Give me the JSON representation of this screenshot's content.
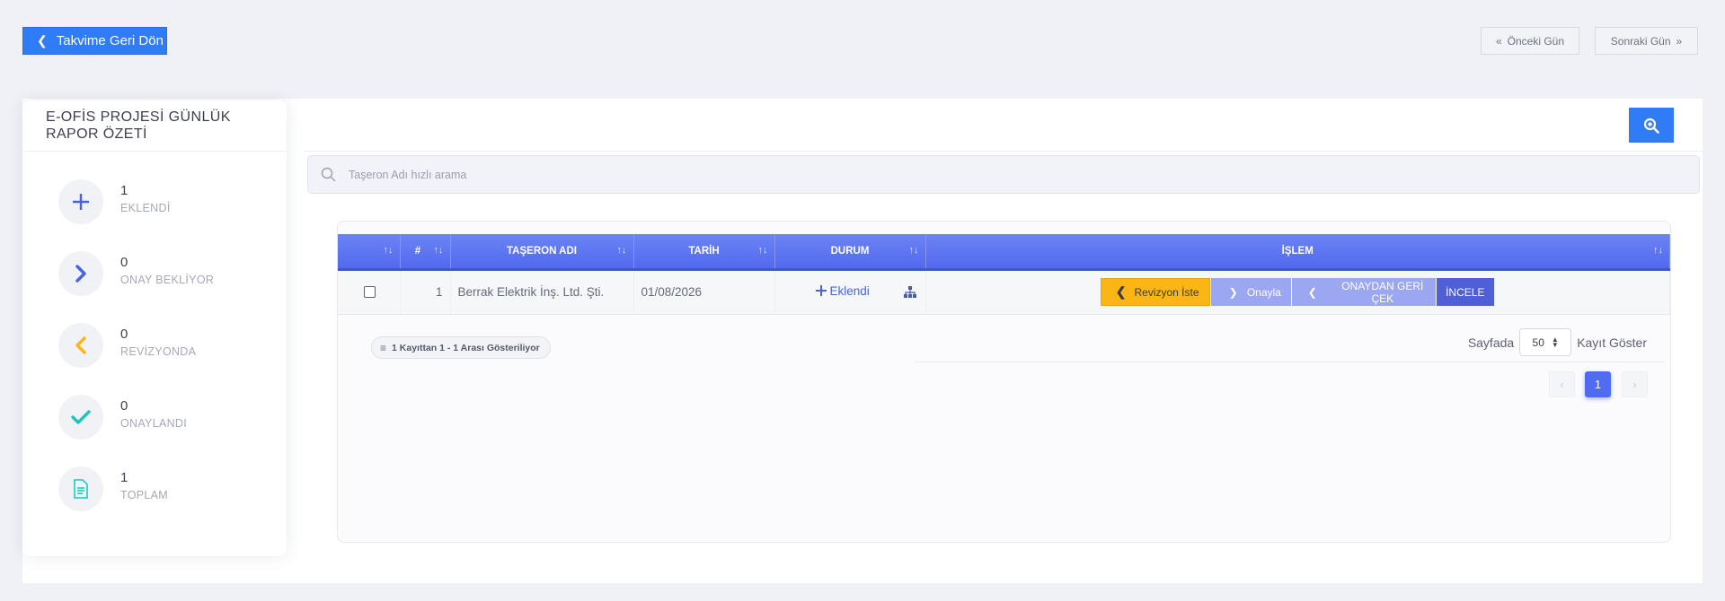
{
  "header": {
    "back_label": "Takvime Geri Dön",
    "prev_day_label": "Önceki Gün",
    "next_day_label": "Sonraki Gün"
  },
  "sidebar": {
    "title": "E-OFİS PROJESİ GÜNLÜK RAPOR ÖZETİ",
    "items": [
      {
        "count": "1",
        "label": "EKLENDİ",
        "icon": "plus-icon",
        "color": "#4763e4"
      },
      {
        "count": "0",
        "label": "ONAY BEKLİYOR",
        "icon": "chevron-right-icon",
        "color": "#4763e4"
      },
      {
        "count": "0",
        "label": "REVİZYONDA",
        "icon": "chevron-left-icon",
        "color": "#fbb515"
      },
      {
        "count": "0",
        "label": "ONAYLANDI",
        "icon": "check-icon",
        "color": "#1bc5bd"
      },
      {
        "count": "1",
        "label": "TOPLAM",
        "icon": "document-icon",
        "color": "#1bc5bd"
      }
    ]
  },
  "search": {
    "placeholder": "Taşeron Adı hızlı arama"
  },
  "table": {
    "columns": [
      "",
      "#",
      "TAŞERON ADI",
      "TARİH",
      "DURUM",
      "İŞLEM"
    ],
    "rows": [
      {
        "no": "1",
        "taseron": "Berrak Elektrik İnş. Ltd. Şti.",
        "tarih": "01/08/2026",
        "durum": "Eklendi",
        "actions": {
          "revizyon": "Revizyon İste",
          "onayla": "Onayla",
          "geri_cek": "ONAYDAN GERİ ÇEK",
          "incele": "İNCELE"
        }
      }
    ]
  },
  "footer": {
    "info": "1 Kayıttan 1 - 1 Arası Gösteriliyor",
    "page_prefix": "Sayfada",
    "page_size": "50",
    "page_suffix": "Kayıt Göster",
    "current_page": "1"
  }
}
